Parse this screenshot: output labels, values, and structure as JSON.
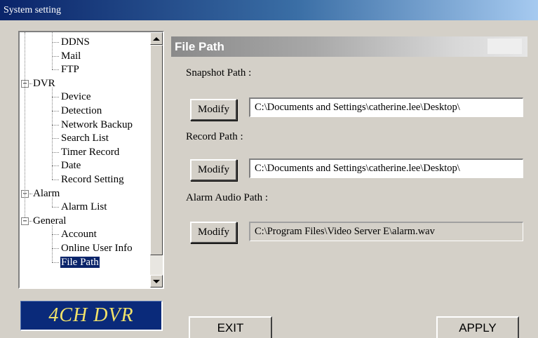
{
  "window": {
    "title": "System setting"
  },
  "tree": {
    "items": [
      {
        "label": "DDNS",
        "level": 2,
        "expander": null,
        "selected": false
      },
      {
        "label": "Mail",
        "level": 2,
        "expander": null,
        "selected": false
      },
      {
        "label": "FTP",
        "level": 2,
        "expander": null,
        "selected": false
      },
      {
        "label": "DVR",
        "level": 1,
        "expander": "−",
        "selected": false
      },
      {
        "label": "Device",
        "level": 2,
        "expander": null,
        "selected": false
      },
      {
        "label": "Detection",
        "level": 2,
        "expander": null,
        "selected": false
      },
      {
        "label": "Network Backup",
        "level": 2,
        "expander": null,
        "selected": false
      },
      {
        "label": "Search List",
        "level": 2,
        "expander": null,
        "selected": false
      },
      {
        "label": "Timer Record",
        "level": 2,
        "expander": null,
        "selected": false
      },
      {
        "label": "Date",
        "level": 2,
        "expander": null,
        "selected": false
      },
      {
        "label": "Record Setting",
        "level": 2,
        "expander": null,
        "selected": false
      },
      {
        "label": "Alarm",
        "level": 1,
        "expander": "−",
        "selected": false
      },
      {
        "label": "Alarm List",
        "level": 2,
        "expander": null,
        "selected": false
      },
      {
        "label": "General",
        "level": 1,
        "expander": "−",
        "selected": false
      },
      {
        "label": "Account",
        "level": 2,
        "expander": null,
        "selected": false
      },
      {
        "label": "Online User Info",
        "level": 2,
        "expander": null,
        "selected": false
      },
      {
        "label": "File Path",
        "level": 2,
        "expander": null,
        "selected": true
      }
    ]
  },
  "logo": {
    "text": "4CH DVR"
  },
  "panel": {
    "title": "File Path",
    "snapshot": {
      "label": "Snapshot Path :",
      "button": "Modify",
      "value": "C:\\Documents and Settings\\catherine.lee\\Desktop\\"
    },
    "record": {
      "label": "Record Path :",
      "button": "Modify",
      "value": "C:\\Documents and Settings\\catherine.lee\\Desktop\\"
    },
    "alarm_audio": {
      "label": "Alarm Audio Path :",
      "button": "Modify",
      "value": "C:\\Program Files\\Video Server E\\alarm.wav"
    }
  },
  "buttons": {
    "exit": "EXIT",
    "apply": "APPLY"
  }
}
